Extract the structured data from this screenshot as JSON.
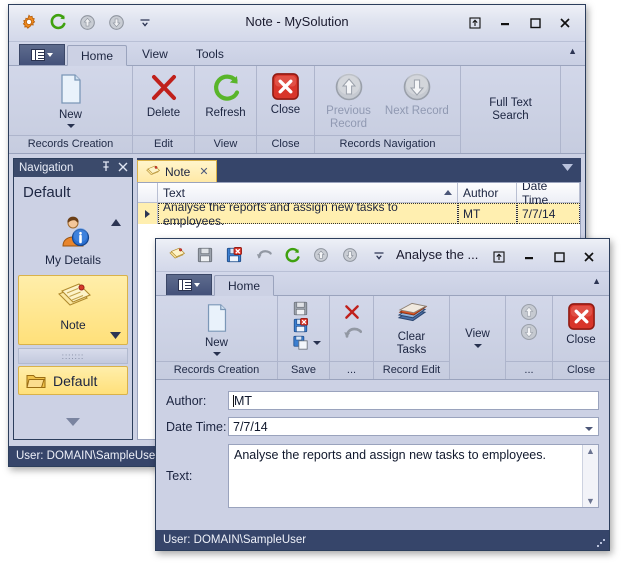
{
  "main_window": {
    "title": "Note - MySolution",
    "quick_access": [
      {
        "name": "options-gear-icon",
        "label": "Options"
      },
      {
        "name": "refresh-icon",
        "label": "Refresh"
      },
      {
        "name": "previous-record-icon",
        "label": "Previous Record"
      },
      {
        "name": "next-record-icon",
        "label": "Next Record"
      },
      {
        "name": "customize-qat-icon",
        "label": "Customize Quick Access Toolbar"
      }
    ],
    "caption_buttons": [
      {
        "name": "restore-layout-button",
        "glyph": "⤒"
      },
      {
        "name": "minimize-button",
        "glyph": "—"
      },
      {
        "name": "maximize-button",
        "glyph": "❑"
      },
      {
        "name": "close-button",
        "glyph": "✕"
      }
    ],
    "app_menu_label": "Application Menu",
    "tabs": [
      {
        "label": "Home",
        "active": true
      },
      {
        "label": "View",
        "active": false
      },
      {
        "label": "Tools",
        "active": false
      }
    ],
    "ribbon_groups": [
      {
        "label": "Records Creation",
        "buttons": [
          {
            "label": "New",
            "icon": "new-document-icon",
            "dropdown": true,
            "disabled": false
          }
        ]
      },
      {
        "label": "Edit",
        "buttons": [
          {
            "label": "Delete",
            "icon": "delete-x-icon",
            "dropdown": false,
            "disabled": false
          }
        ]
      },
      {
        "label": "View",
        "buttons": [
          {
            "label": "Refresh",
            "icon": "refresh-icon",
            "dropdown": false,
            "disabled": false
          }
        ]
      },
      {
        "label": "Close",
        "buttons": [
          {
            "label": "Close",
            "icon": "close-red-icon",
            "dropdown": false,
            "disabled": false
          }
        ]
      },
      {
        "label": "Records Navigation",
        "buttons": [
          {
            "label": "Previous\nRecord",
            "icon": "arrow-up-circle-icon",
            "dropdown": false,
            "disabled": true
          },
          {
            "label": "Next Record",
            "icon": "arrow-down-circle-icon",
            "dropdown": false,
            "disabled": true
          }
        ]
      },
      {
        "label": "",
        "buttons": [
          {
            "label": "Full Text\nSearch",
            "icon": "",
            "dropdown": true,
            "disabled": false
          }
        ]
      }
    ],
    "navigation": {
      "caption": "Navigation",
      "pin_glyph": "↯",
      "close_glyph": "✕",
      "header": "Default",
      "items": [
        {
          "label": "My Details",
          "icon": "user-details-icon",
          "selected": false
        },
        {
          "label": "Note",
          "icon": "note-icon",
          "selected": true
        }
      ],
      "flat_item": {
        "label": "Default",
        "icon": "folder-icon"
      },
      "scroll_up_glyph": "▲",
      "scroll_down_glyph": "▼"
    },
    "document_tabs": [
      {
        "label": "Note",
        "icon": "note-icon",
        "close_glyph": "✕",
        "active": true
      }
    ],
    "grid": {
      "columns": [
        {
          "header": "Text",
          "sorted": "asc"
        },
        {
          "header": "Author",
          "sorted": ""
        },
        {
          "header": "Date Time",
          "sorted": ""
        }
      ],
      "rows": [
        {
          "selected": true,
          "cells": [
            "Analyse the reports and assign new tasks to employees.",
            "MT",
            "7/7/14"
          ]
        }
      ]
    },
    "status_text": "User: DOMAIN\\SampleUser"
  },
  "child_window": {
    "title": "Analyse the ...",
    "quick_access": [
      {
        "name": "note-icon",
        "label": "Note"
      },
      {
        "name": "save-icon",
        "label": "Save"
      },
      {
        "name": "save-close-icon",
        "label": "Save and Close"
      },
      {
        "name": "undo-icon",
        "label": "Undo"
      },
      {
        "name": "refresh-icon",
        "label": "Refresh"
      },
      {
        "name": "previous-record-icon",
        "label": "Previous Record"
      },
      {
        "name": "next-record-icon",
        "label": "Next Record"
      },
      {
        "name": "customize-qat-icon",
        "label": "Customize Quick Access Toolbar"
      }
    ],
    "caption_buttons": [
      {
        "name": "restore-layout-button",
        "glyph": "⤒"
      },
      {
        "name": "minimize-button",
        "glyph": "—"
      },
      {
        "name": "maximize-button",
        "glyph": "❑"
      },
      {
        "name": "close-button",
        "glyph": "✕"
      }
    ],
    "app_menu_label": "Application Menu",
    "tabs": [
      {
        "label": "Home",
        "active": true
      }
    ],
    "ribbon_groups": [
      {
        "label": "Records Creation",
        "buttons": [
          {
            "label": "New",
            "icon": "new-document-icon",
            "dropdown": true,
            "disabled": false
          }
        ]
      },
      {
        "label": "Save",
        "buttons": [
          {
            "label": "",
            "icon": "save-icon",
            "dropdown": false,
            "disabled": true
          },
          {
            "label": "",
            "icon": "save-close-icon",
            "dropdown": false,
            "disabled": false
          },
          {
            "label": "",
            "icon": "save-new-icon",
            "dropdown": true,
            "disabled": false
          }
        ]
      },
      {
        "label": "...",
        "buttons": [
          {
            "label": "",
            "icon": "delete-x-icon",
            "dropdown": false,
            "disabled": false
          },
          {
            "label": "",
            "icon": "undo-icon",
            "dropdown": false,
            "disabled": true
          }
        ]
      },
      {
        "label": "Record Edit",
        "buttons": [
          {
            "label": "Clear\nTasks",
            "icon": "clear-tasks-book-icon",
            "dropdown": false,
            "disabled": false
          }
        ]
      },
      {
        "label": "",
        "buttons": [
          {
            "label": "View",
            "icon": "",
            "dropdown": true,
            "disabled": false
          }
        ]
      },
      {
        "label": "...",
        "buttons": [
          {
            "label": "",
            "icon": "arrow-up-circle-icon",
            "dropdown": false,
            "disabled": true
          },
          {
            "label": "",
            "icon": "arrow-down-circle-icon",
            "dropdown": false,
            "disabled": true
          }
        ]
      },
      {
        "label": "Close",
        "buttons": [
          {
            "label": "Close",
            "icon": "close-red-icon",
            "dropdown": false,
            "disabled": false
          }
        ]
      }
    ],
    "form": {
      "author_label": "Author:",
      "author_value": "MT",
      "datetime_label": "Date Time:",
      "datetime_value": "7/7/14",
      "text_label": "Text:",
      "text_value": "Analyse the reports and assign new tasks to employees.",
      "scroll_up_glyph": "▲",
      "scroll_down_glyph": "▼"
    },
    "status_text": "User: DOMAIN\\SampleUser"
  },
  "colors": {
    "accent_dark": "#36456a",
    "ribbon_bg": "#ccd1e4",
    "selection_yellow": "#ffe07a",
    "close_red": "#cc2b20",
    "refresh_green": "#46a519"
  }
}
